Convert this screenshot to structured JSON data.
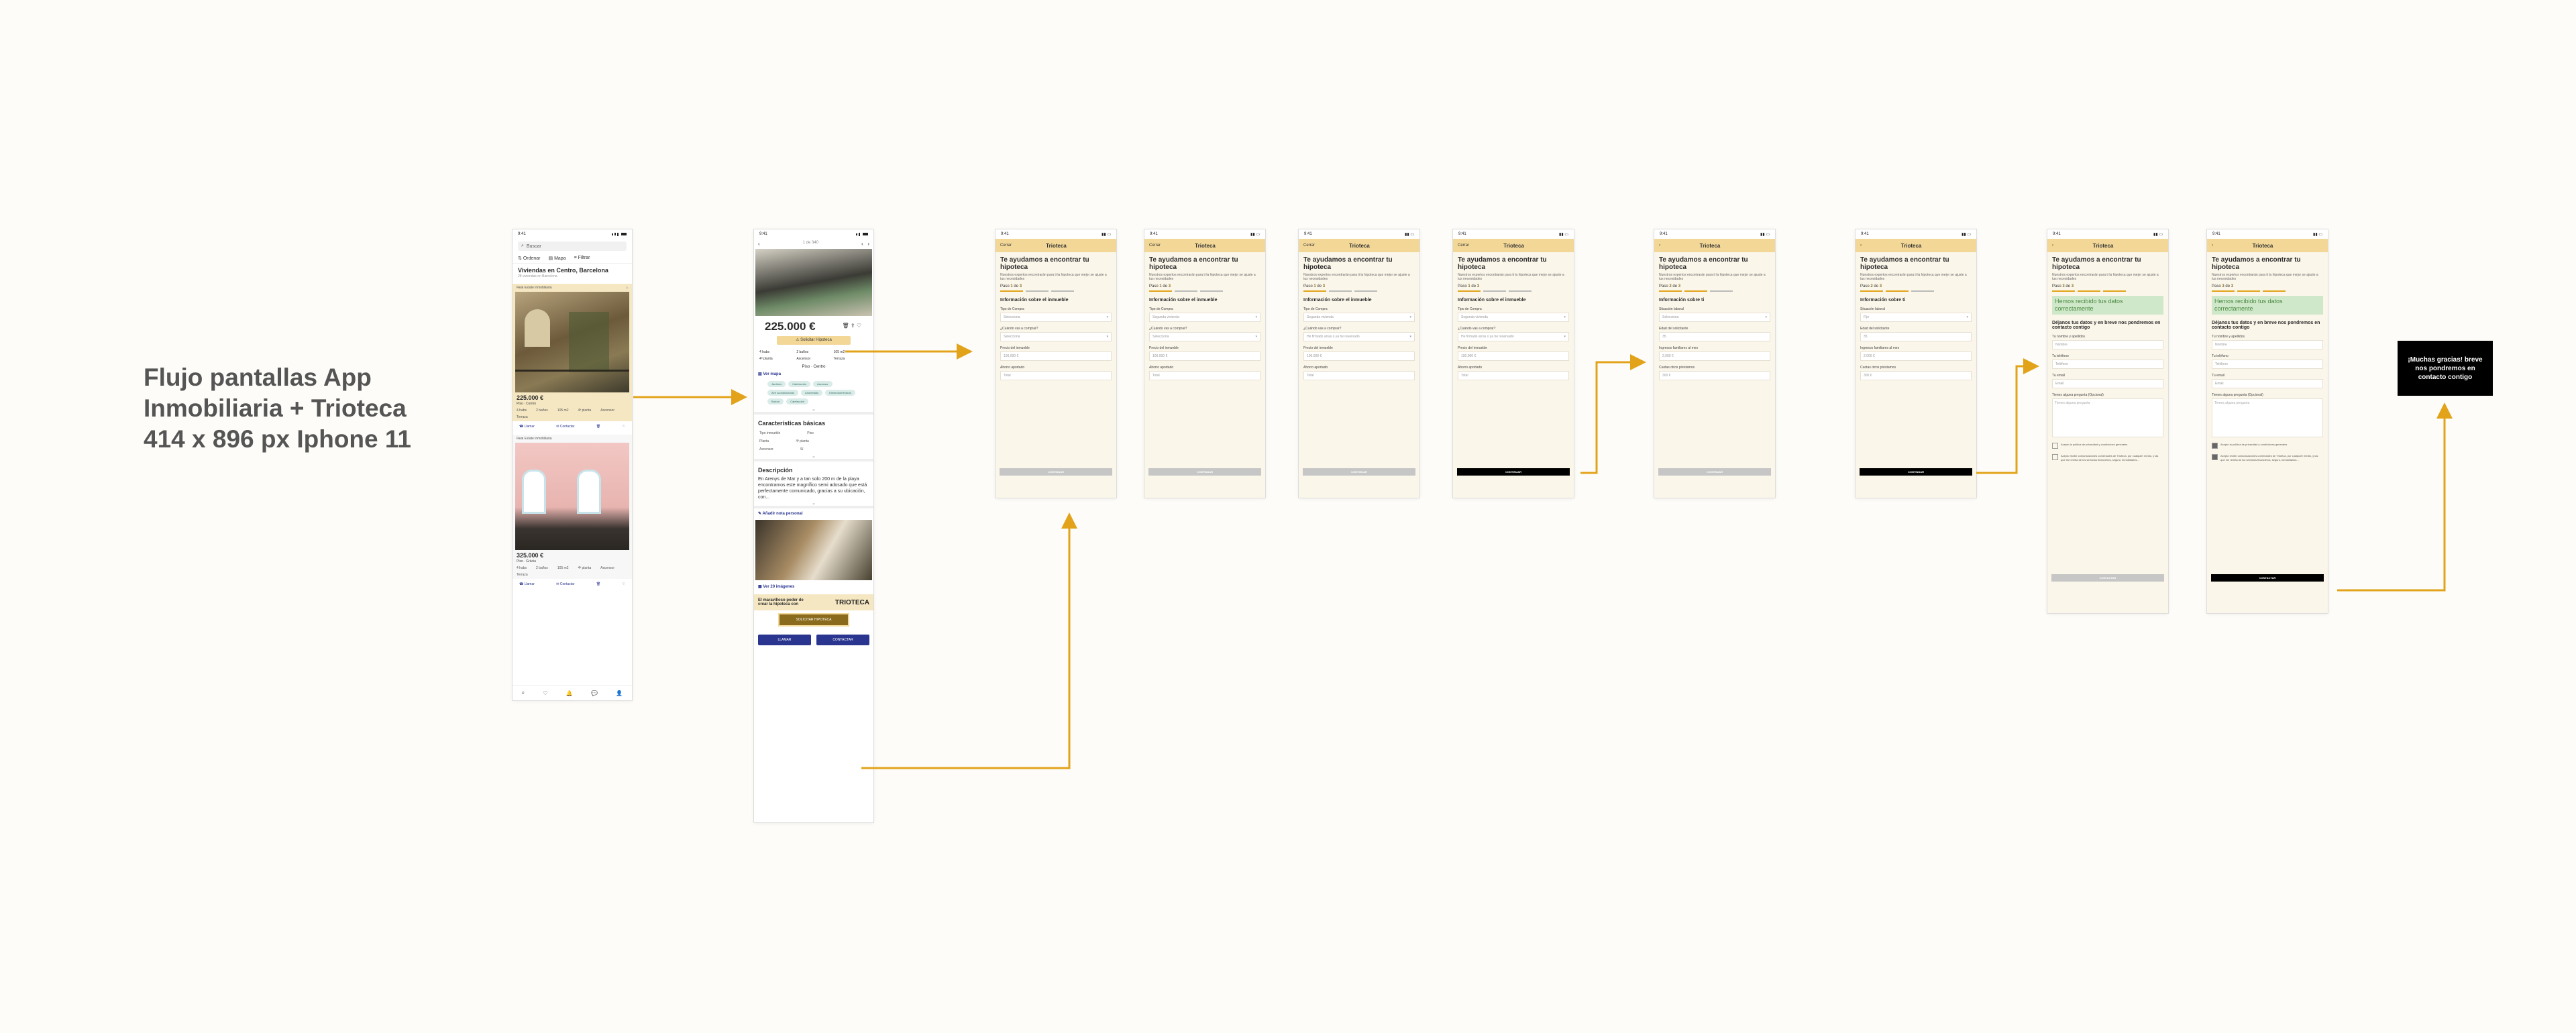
{
  "canvas": {
    "title_lines": [
      "Flujo pantallas App",
      "Inmobiliaria + Trioteca",
      "414 x 896 px Iphone 11"
    ]
  },
  "colors": {
    "accent": "#e2a31a",
    "form_header": "#f2d797",
    "form_bg": "#fbf6ea",
    "brand_blue": "#2a3590",
    "success": "#cfe8c9"
  },
  "status_time": "9:41",
  "listing": {
    "search_placeholder": "Buscar",
    "filters": [
      "Ordenar",
      "Mapa",
      "Filtrar"
    ],
    "heading": "Viviendas en Centro, Barcelona",
    "subheading": "28 viviendas en Barcelona",
    "cards": [
      {
        "agency": "Real Estate inmobiliaria",
        "price": "225.000 €",
        "type": "Piso · Centro",
        "feats": [
          "4 habs",
          "2 baños",
          "105 m2",
          "4ª planta",
          "Ascensor",
          "Terraza"
        ],
        "actions": [
          "Llamar",
          "Contactar"
        ]
      },
      {
        "agency": "Real Estate inmobiliaria",
        "price": "325.000 €",
        "type": "Piso · Gràcia",
        "feats": [
          "4 habs",
          "2 baños",
          "105 m2",
          "4ª planta",
          "Ascensor",
          "Terraza"
        ],
        "actions": [
          "Llamar",
          "Contactar"
        ]
      }
    ],
    "tabs": [
      "search-icon",
      "heart-icon",
      "bell-icon",
      "chat-icon",
      "user-icon"
    ]
  },
  "detail": {
    "counter": "1 de 340",
    "price": "225.000 €",
    "hipoteca_button": "Solicitar Hipoteca",
    "feats": [
      "4 habs",
      "2 baños",
      "105 m2",
      "4ª planta",
      "Ascensor",
      "Terraza"
    ],
    "type": "Piso · Centro",
    "map_link": "Ver mapa",
    "chips": [
      "Jardines",
      "Calefacción",
      "Ascensor",
      "Aire acondicionado",
      "Amueblado",
      "Electrodomésticos",
      "Balcón",
      "Calefacción"
    ],
    "basic_title": "Características básicas",
    "basic_rows": [
      [
        "Tipo inmueble",
        "Piso"
      ],
      [
        "Planta",
        "4ª planta"
      ],
      [
        "Ascensor",
        "Sí"
      ]
    ],
    "desc_title": "Descripción",
    "desc_text": "En Arenys de Mar y a tan solo 200 m de la playa encontramos este magnífico semi adosado que está perfectamente comunicado, gracias a su ubicación, con...",
    "note_link": "Añadir nota personal",
    "photos_link": "Ver 20 imágenes",
    "trio_text": "El maravilloso poder de crear la hipoteca con",
    "trio_brand": "TRIOTECA",
    "solicit_button": "SOLICITAR HIPOTECA",
    "call_button": "LLAMAR",
    "contact_button": "CONTACTAR"
  },
  "form": {
    "cancel": "Cerrar",
    "brand": "Trioteca",
    "title": "Te ayudamos a encontrar tu hipoteca",
    "subtitle": "Nuestros expertos encontrarán para ti la hipoteca que mejor se ajuste a tus necesidades",
    "section_inmueble": "Información sobre el inmueble",
    "section_tu": "Información sobre ti",
    "labels_inmueble": [
      "Tipo de Compra",
      "¿Cuándo vas a comprar?",
      "Precio del inmueble",
      "Ahorro aportado"
    ],
    "labels_tu": [
      "Situación laboral",
      "Edad del solicitante",
      "Ingresos familiares al mes",
      "Cuotas otros préstamos"
    ],
    "ph_select": "Selecciona",
    "ph_second": "Segunda vivienda",
    "ph_when": "He firmado arras o ya he reservado",
    "ph_price": "100.000 €",
    "ph_total": "Total",
    "ph_fijo": "Fijo",
    "ph_age": "35",
    "ph_income": "2.000 €",
    "ph_loans": "300 €",
    "continue": "CONTINUAR",
    "contact": "CONTACTAR",
    "success": "Hemos recibido tus datos correctamente",
    "leave_title": "Déjanos tus datos y en breve nos pondremos en contacto contigo",
    "labels_contact": [
      "Tu nombre y apellidos",
      "Tu teléfono",
      "Tu email",
      "Tienes alguna pregunta (Opcional)"
    ],
    "ph_contact": [
      "Nombre",
      "Teléfono",
      "Email",
      "Tienes alguna pregunta"
    ],
    "check1": "Acepto la política de privacidad y condiciones generales",
    "check2": "Acepto recibir comunicaciones comerciales de Trioteca, por cualquier medio, y las que me remita de los servicios financieros, seguro, inmobiliarios...",
    "screens": [
      {
        "paso": "1",
        "total": "3"
      },
      {
        "paso": "1",
        "total": "3"
      },
      {
        "paso": "1",
        "total": "3"
      },
      {
        "paso": "1",
        "total": "3"
      },
      {
        "paso": "2",
        "total": "3"
      },
      {
        "paso": "2",
        "total": "3"
      },
      {
        "paso": "3",
        "total": "3"
      },
      {
        "paso": "3",
        "total": "3"
      }
    ]
  },
  "thanks": "¡Muchas gracias! breve nos pondremos en contacto contigo"
}
